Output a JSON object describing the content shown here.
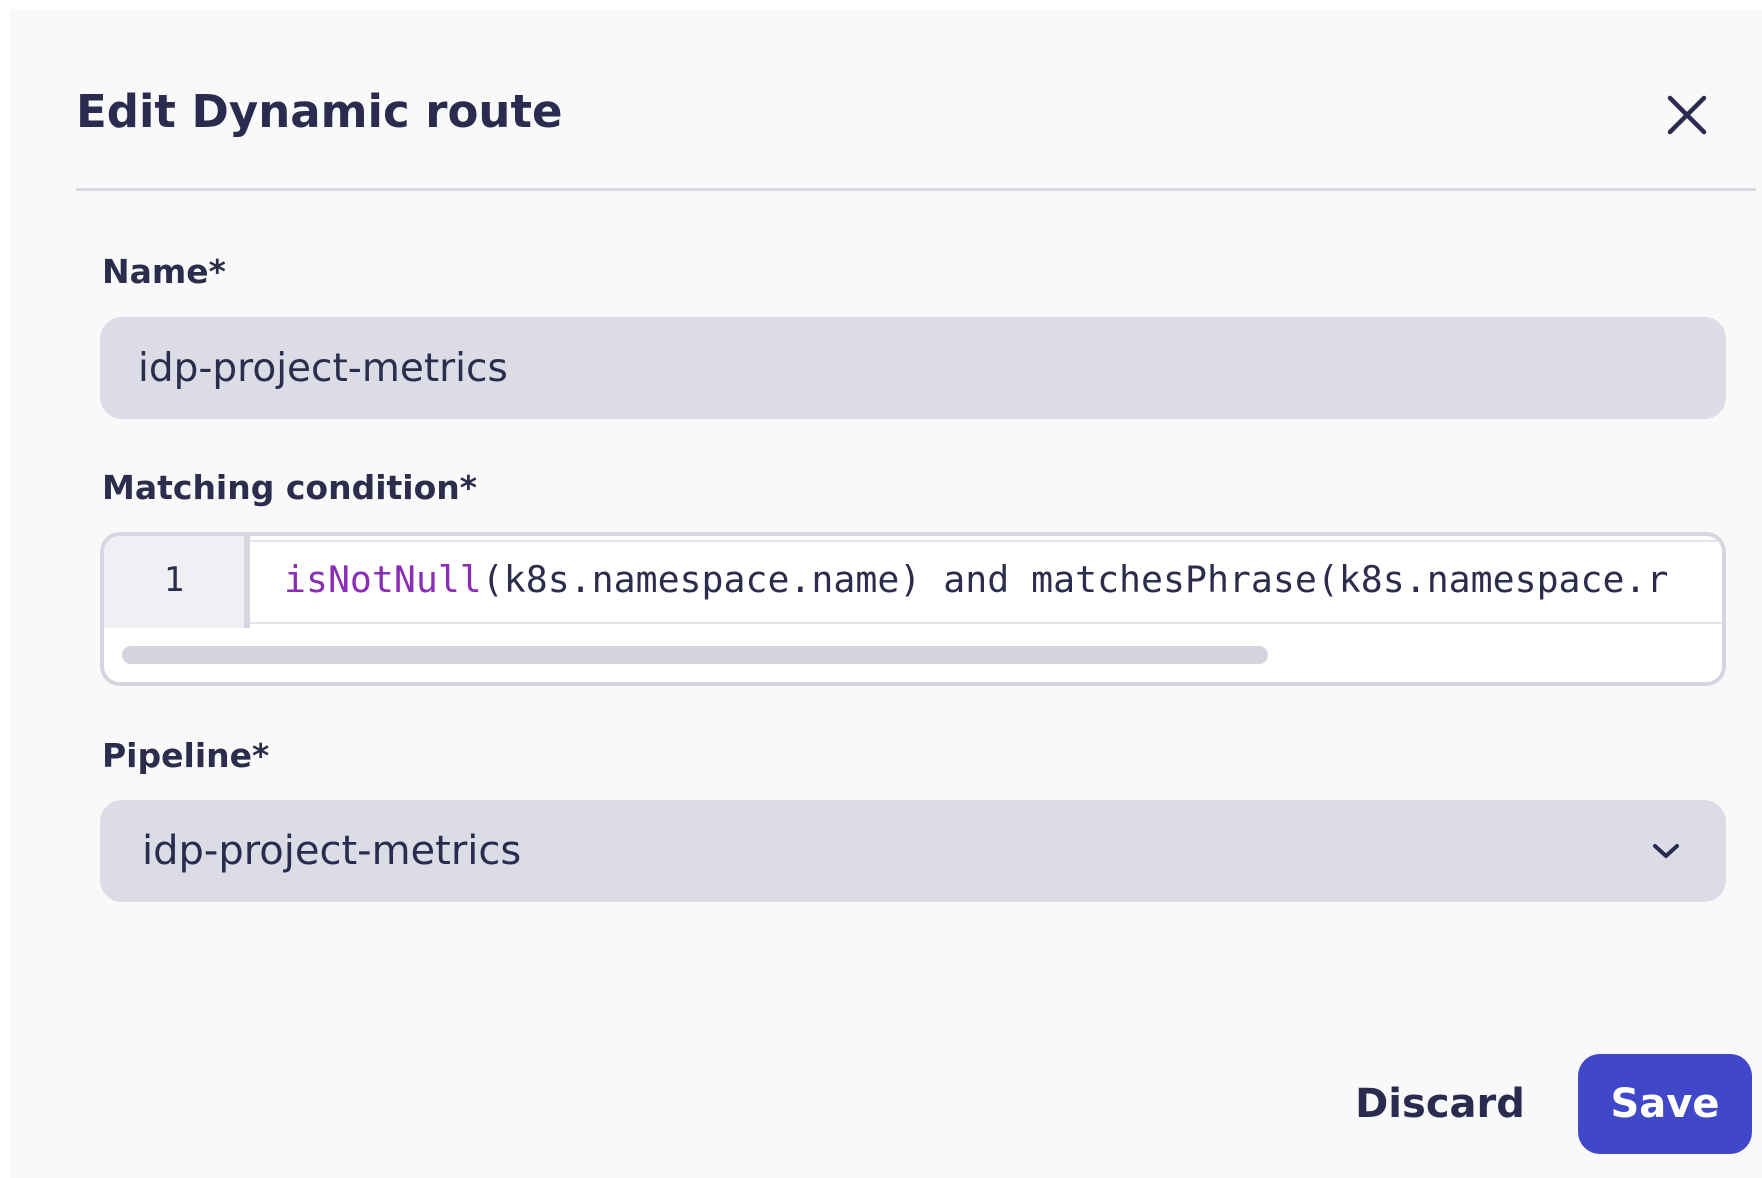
{
  "dialog": {
    "title": "Edit Dynamic route",
    "close_icon": "close-icon"
  },
  "form": {
    "name": {
      "label": "Name*",
      "value": "idp-project-metrics"
    },
    "matching_condition": {
      "label": "Matching condition*",
      "line_number": "1",
      "code_function": "isNotNull",
      "code_rest": "(k8s.namespace.name) and matchesPhrase(k8s.namespace.r"
    },
    "pipeline": {
      "label": "Pipeline*",
      "selected": "idp-project-metrics",
      "dropdown_icon": "chevron-down-icon"
    }
  },
  "footer": {
    "discard_label": "Discard",
    "save_label": "Save"
  },
  "colors": {
    "primary": "#4147c9",
    "text": "#2b2b4f",
    "input_background": "#dcdce6",
    "code_function": "#8a2fb5",
    "dialog_background": "#f9f9fa"
  }
}
